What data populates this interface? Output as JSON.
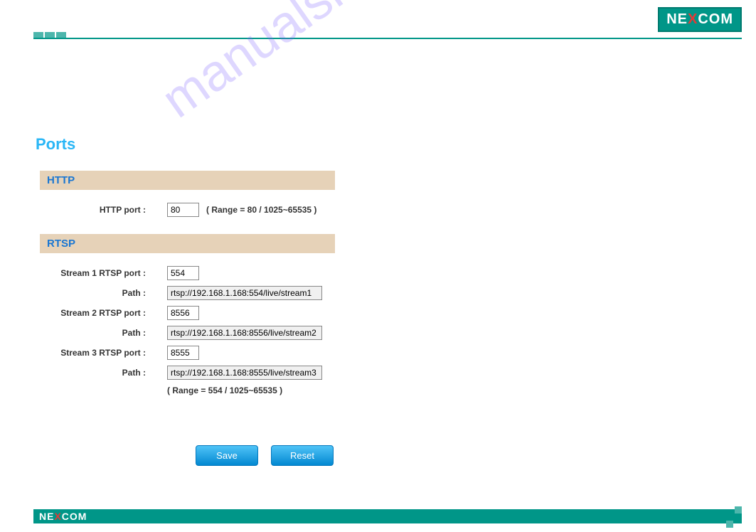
{
  "brand": {
    "name_part1": "NE",
    "name_x": "X",
    "name_part2": "COM"
  },
  "page": {
    "title": "Ports"
  },
  "http": {
    "section_title": "HTTP",
    "port_label": "HTTP port :",
    "port_value": "80",
    "port_hint": "( Range = 80 / 1025~65535 )"
  },
  "rtsp": {
    "section_title": "RTSP",
    "streams": [
      {
        "port_label": "Stream 1 RTSP port :",
        "port_value": "554",
        "path_label": "Path :",
        "path_value": "rtsp://192.168.1.168:554/live/stream1"
      },
      {
        "port_label": "Stream 2 RTSP port :",
        "port_value": "8556",
        "path_label": "Path :",
        "path_value": "rtsp://192.168.1.168:8556/live/stream2"
      },
      {
        "port_label": "Stream 3 RTSP port :",
        "port_value": "8555",
        "path_label": "Path :",
        "path_value": "rtsp://192.168.1.168:8555/live/stream3"
      }
    ],
    "range_hint": "( Range = 554 / 1025~65535 )"
  },
  "buttons": {
    "save": "Save",
    "reset": "Reset"
  },
  "watermark": "manualshive.com"
}
